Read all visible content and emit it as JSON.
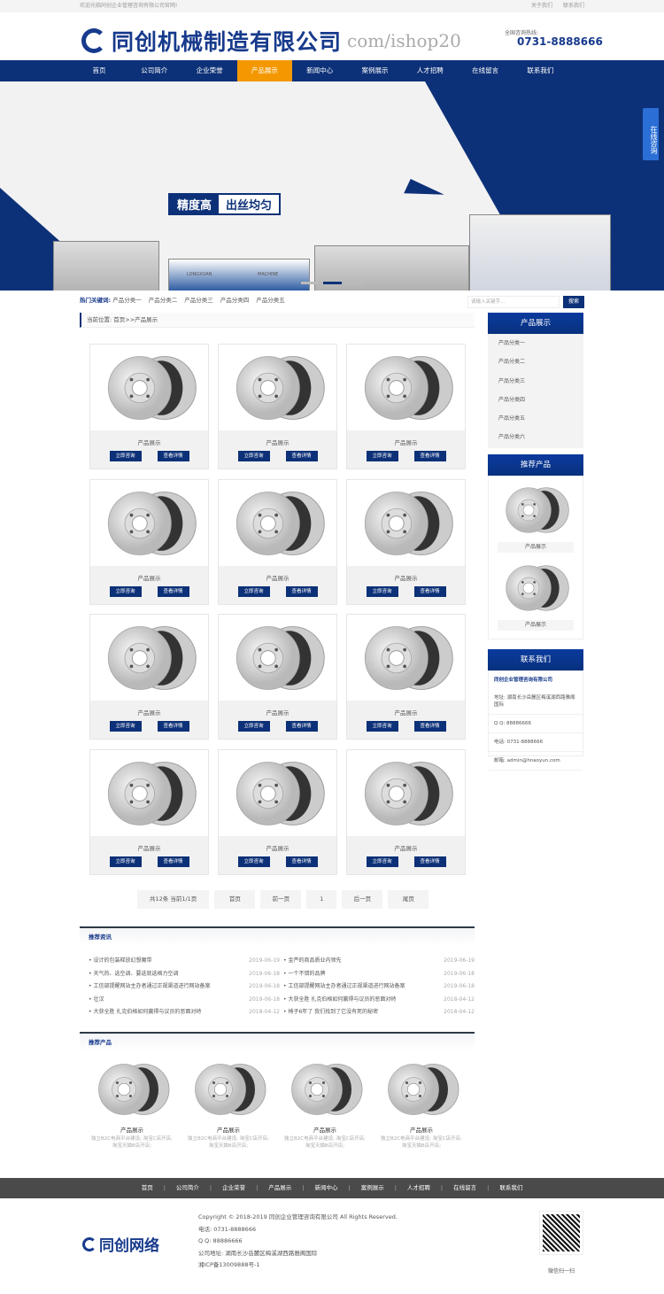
{
  "topbar": {
    "welcome": "欢迎光临同创企业管理咨询有限公司官网!",
    "links": [
      "关于我们",
      "联系我们"
    ]
  },
  "header": {
    "logo_text": "同创机械制造有限公司",
    "watermark": "com/ishop20",
    "hotline_label": "全国咨询热线:",
    "hotline": "0731-8888666"
  },
  "nav": {
    "items": [
      "首页",
      "公司简介",
      "企业荣誉",
      "产品展示",
      "新闻中心",
      "案例展示",
      "人才招聘",
      "在线留言",
      "联系我们"
    ],
    "active": 3
  },
  "banner": {
    "slogan_a": "精度高",
    "slogan_b": "出丝均匀",
    "machine_labels": [
      "LONGXUAN",
      "MACHINE"
    ],
    "slides": 3,
    "active_slide": 1
  },
  "consult": "在线咨询",
  "keywords": {
    "label": "热门关键词:",
    "items": [
      "产品分类一",
      "产品分类二",
      "产品分类三",
      "产品分类四",
      "产品分类五"
    ]
  },
  "search": {
    "placeholder": "请输入关键字...",
    "button": "搜索"
  },
  "breadcrumb": "当前位置: 首页>>产品展示",
  "products": {
    "title": "产品展示",
    "consult_btn": "立即咨询",
    "detail_btn": "查看详情",
    "count": 12
  },
  "pager": [
    "共12条 当前1/1页",
    "首页",
    "前一页",
    "1",
    "后一页",
    "尾页"
  ],
  "news": {
    "title": "推荐资讯",
    "items": [
      {
        "t": "设计的包装释放幻想魔带",
        "d": "2019-06-19"
      },
      {
        "t": "金芦的商品质业内领先",
        "d": "2019-06-19"
      },
      {
        "t": "天气热、选空调、要选就选格力空调",
        "d": "2019-06-18"
      },
      {
        "t": "一个不错的品牌",
        "d": "2019-06-18"
      },
      {
        "t": "工信部提醒网站主办者通过正规渠道进行网站备案",
        "d": "2019-06-18"
      },
      {
        "t": "工信部提醒网站主办者通过正规渠道进行网站备案",
        "d": "2019-06-18"
      },
      {
        "t": "壮汉",
        "d": "2019-06-18"
      },
      {
        "t": "大获全胜 扎克伯格如何赢得与议员的恶面对峙",
        "d": "2018-04-12"
      },
      {
        "t": "大获全胜 扎克伯格如何赢得与议员的恶面对峙",
        "d": "2018-04-12"
      },
      {
        "t": "椅子6年了 我们找到了它没有死的秘密",
        "d": "2018-04-12"
      }
    ]
  },
  "rec": {
    "title": "推荐产品",
    "item_title": "产品展示",
    "item_desc": "独立B2C电商平台建设; 淘宝C店开店; 淘宝天猫B店开店;"
  },
  "sidebar": {
    "cat_title": "产品展示",
    "cats": [
      "产品分类一",
      "产品分类二",
      "产品分类三",
      "产品分类四",
      "产品分类五",
      "产品分类六"
    ],
    "rec_title": "推荐产品",
    "rec_item": "产品展示",
    "contact_title": "联系我们",
    "company": "同创企业管理咨询有限公司",
    "address": "地址: 湖南长沙岳麓区梅溪湖西路雅阁国际",
    "qq": "Q Q: 88886666",
    "phone": "电话: 0731-8888666",
    "email": "邮箱: admin@hnaoyun.com"
  },
  "footer": {
    "nav": [
      "首页",
      "公司简介",
      "企业荣誉",
      "产品展示",
      "新闻中心",
      "案例展示",
      "人才招聘",
      "在线留言",
      "联系我们"
    ],
    "logo_text": "同创网络",
    "lines": [
      "Copyright © 2018-2019 同创企业管理咨询有限公司 All Rights Reserved.",
      "电话: 0731-8888666",
      "Q Q: 88886666",
      "公司地址: 湖南长沙岳麓区梅溪湖西路雅阁国际",
      "湘ICP备13009888号-1"
    ],
    "qr_caption": "微信扫一扫"
  },
  "colors": {
    "primary": "#0d3178",
    "accent": "#f39800",
    "footer": "#4a4a4a"
  }
}
